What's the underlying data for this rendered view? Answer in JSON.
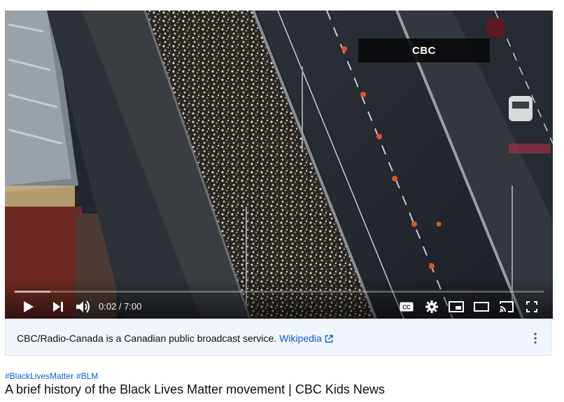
{
  "player": {
    "watermark": "CBC",
    "time_display": "0:02 / 7:00",
    "progress_played_fraction": 0.003,
    "progress_loaded_fraction": 0.07,
    "controls": [
      "play-icon",
      "next-icon",
      "volume-icon",
      "cc-icon",
      "gear-icon",
      "miniplayer-icon",
      "theater-icon",
      "cast-icon",
      "fullscreen-icon"
    ]
  },
  "info_panel": {
    "text": "CBC/Radio-Canada is a Canadian public broadcast service.",
    "link_label": "Wikipedia",
    "link_icon": "external-link-icon",
    "menu_icon": "more-vert-icon"
  },
  "hashtags": [
    "#BlackLivesMatter",
    "#BLM"
  ],
  "video_title": "A brief history of the Black Lives Matter movement | CBC Kids News",
  "colors": {
    "progress": "#ff0000",
    "link": "#065fd4",
    "panel_bg": "#f0f6fc"
  }
}
